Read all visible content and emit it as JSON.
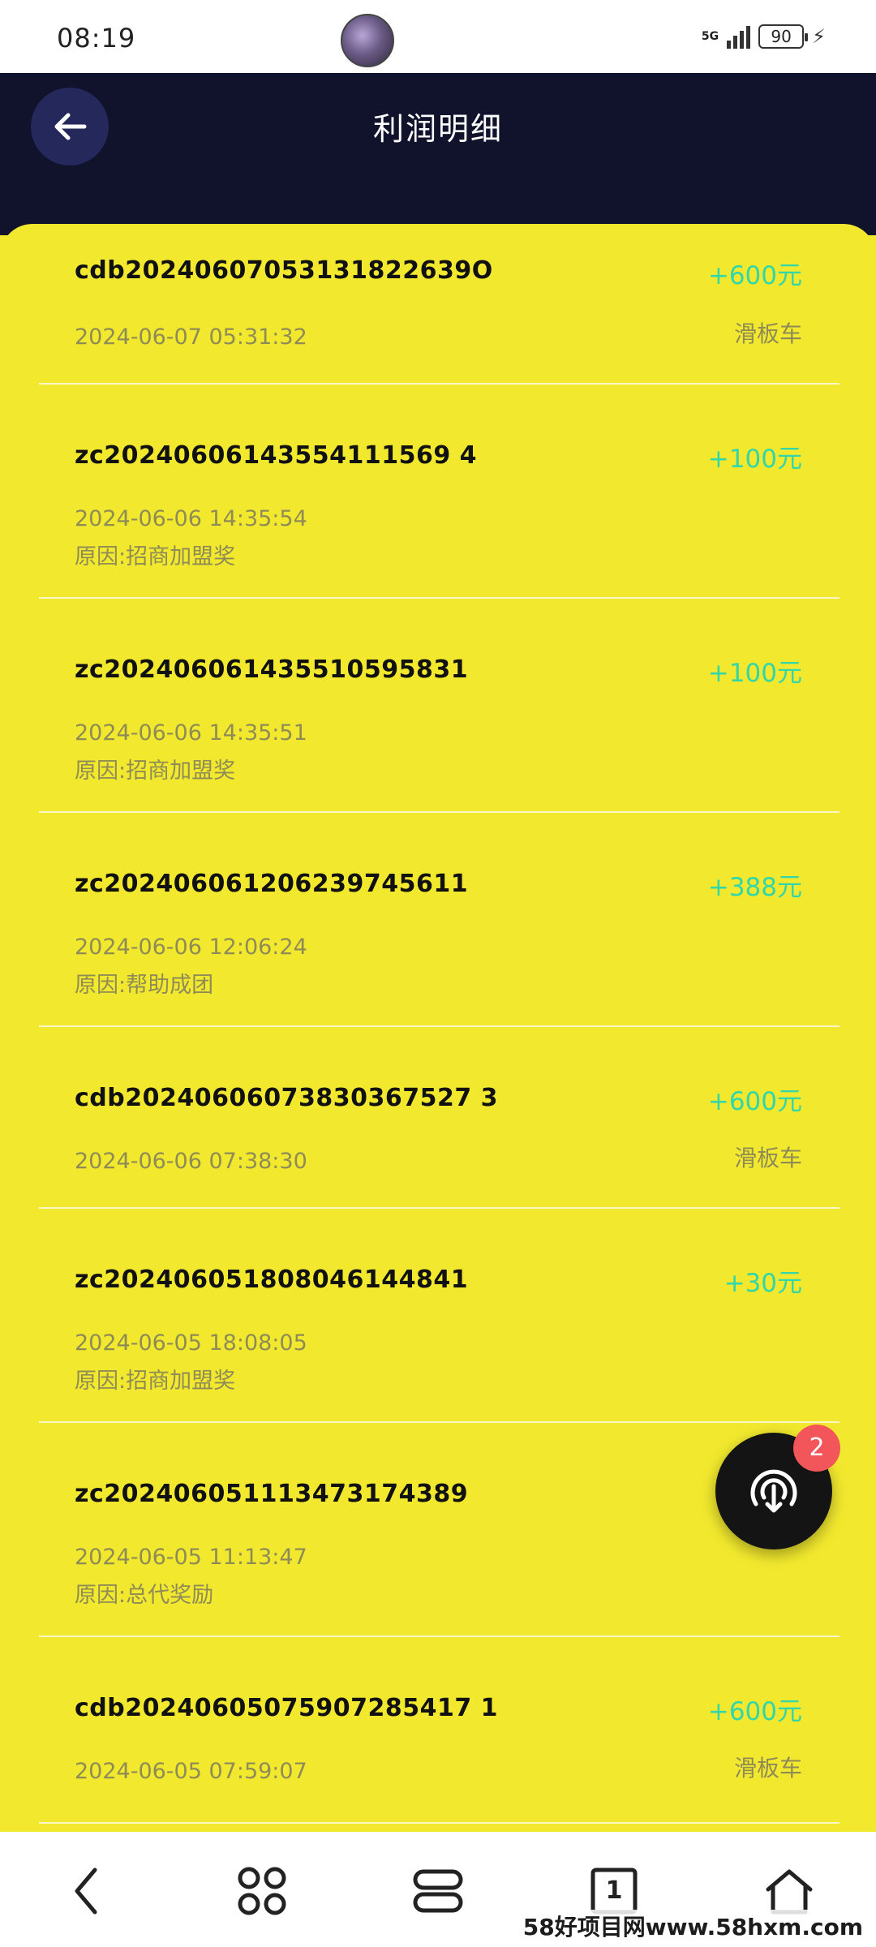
{
  "status_bar": {
    "time": "08:19",
    "network": "5G",
    "battery": "90"
  },
  "header": {
    "title": "利润明细"
  },
  "records": [
    {
      "id": "cdb20240607053131822639O",
      "time": "2024-06-07 05:31:32",
      "reason": "",
      "amount": "+600元",
      "product": "滑板车"
    },
    {
      "id": "zc20240606143554111569 4",
      "time": "2024-06-06 14:35:54",
      "reason": "原因:招商加盟奖",
      "amount": "+100元",
      "product": ""
    },
    {
      "id": "zc202406061435510595831",
      "time": "2024-06-06 14:35:51",
      "reason": "原因:招商加盟奖",
      "amount": "+100元",
      "product": ""
    },
    {
      "id": "zc202406061206239745611",
      "time": "2024-06-06 12:06:24",
      "reason": "原因:帮助成团",
      "amount": "+388元",
      "product": ""
    },
    {
      "id": "cdb20240606073830367527 3",
      "time": "2024-06-06 07:38:30",
      "reason": "",
      "amount": "+600元",
      "product": "滑板车"
    },
    {
      "id": "zc202406051808046144841",
      "time": "2024-06-05 18:08:05",
      "reason": "原因:招商加盟奖",
      "amount": "+30元",
      "product": ""
    },
    {
      "id": "zc202406051113473174389",
      "time": "2024-06-05 11:13:47",
      "reason": "原因:总代奖励",
      "amount": "",
      "product": ""
    },
    {
      "id": "cdb20240605075907285417 1",
      "time": "2024-06-05 07:59:07",
      "reason": "",
      "amount": "+600元",
      "product": "滑板车"
    }
  ],
  "fab": {
    "badge": "2",
    "icon": "download-broadcast-icon"
  },
  "bottom_nav": {
    "items": [
      "back-icon",
      "apps-icon",
      "tabs-icon",
      "page-count-icon",
      "home-icon"
    ],
    "page_count": "1"
  },
  "watermark": "58好项目网www.58hxm.com",
  "colors": {
    "header_bg": "#11132c",
    "card_bg": "#f2e92e",
    "amount": "#32d6a8",
    "badge": "#f2555a"
  }
}
